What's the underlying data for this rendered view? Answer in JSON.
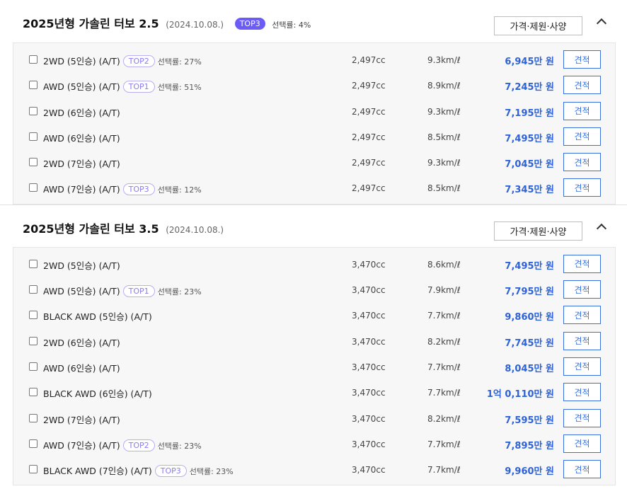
{
  "sections": [
    {
      "title": "2025년형 가솔린 터보 2.5",
      "date": "(2024.10.08.)",
      "badge": "TOP3",
      "rate": "선택률: 4%",
      "spec_label": "가격·제원·사양",
      "trims": [
        {
          "name": "2WD (5인승) (A/T)",
          "badge": "TOP2",
          "rate": "선택률: 27%",
          "cc": "2,497cc",
          "eff": "9.3km/ℓ",
          "price": "6,945만 원",
          "quote": "견적"
        },
        {
          "name": "AWD (5인승) (A/T)",
          "badge": "TOP1",
          "rate": "선택률: 51%",
          "cc": "2,497cc",
          "eff": "8.9km/ℓ",
          "price": "7,245만 원",
          "quote": "견적"
        },
        {
          "name": "2WD (6인승) (A/T)",
          "cc": "2,497cc",
          "eff": "9.3km/ℓ",
          "price": "7,195만 원",
          "quote": "견적"
        },
        {
          "name": "AWD (6인승) (A/T)",
          "cc": "2,497cc",
          "eff": "8.5km/ℓ",
          "price": "7,495만 원",
          "quote": "견적"
        },
        {
          "name": "2WD (7인승) (A/T)",
          "cc": "2,497cc",
          "eff": "9.3km/ℓ",
          "price": "7,045만 원",
          "quote": "견적"
        },
        {
          "name": "AWD (7인승) (A/T)",
          "badge": "TOP3",
          "rate": "선택률: 12%",
          "cc": "2,497cc",
          "eff": "8.5km/ℓ",
          "price": "7,345만 원",
          "quote": "견적"
        }
      ]
    },
    {
      "title": "2025년형 가솔린 터보 3.5",
      "date": "(2024.10.08.)",
      "spec_label": "가격·제원·사양",
      "trims": [
        {
          "name": "2WD (5인승) (A/T)",
          "cc": "3,470cc",
          "eff": "8.6km/ℓ",
          "price": "7,495만 원",
          "quote": "견적"
        },
        {
          "name": "AWD (5인승) (A/T)",
          "badge": "TOP1",
          "rate": "선택률: 23%",
          "cc": "3,470cc",
          "eff": "7.9km/ℓ",
          "price": "7,795만 원",
          "quote": "견적"
        },
        {
          "name": "BLACK AWD (5인승) (A/T)",
          "cc": "3,470cc",
          "eff": "7.7km/ℓ",
          "price": "9,860만 원",
          "quote": "견적"
        },
        {
          "name": "2WD (6인승) (A/T)",
          "cc": "3,470cc",
          "eff": "8.2km/ℓ",
          "price": "7,745만 원",
          "quote": "견적"
        },
        {
          "name": "AWD (6인승) (A/T)",
          "cc": "3,470cc",
          "eff": "7.7km/ℓ",
          "price": "8,045만 원",
          "quote": "견적"
        },
        {
          "name": "BLACK AWD (6인승) (A/T)",
          "cc": "3,470cc",
          "eff": "7.7km/ℓ",
          "price": "1억 0,110만 원",
          "quote": "견적"
        },
        {
          "name": "2WD (7인승) (A/T)",
          "cc": "3,470cc",
          "eff": "8.2km/ℓ",
          "price": "7,595만 원",
          "quote": "견적"
        },
        {
          "name": "AWD (7인승) (A/T)",
          "badge": "TOP2",
          "rate": "선택률: 23%",
          "cc": "3,470cc",
          "eff": "7.7km/ℓ",
          "price": "7,895만 원",
          "quote": "견적"
        },
        {
          "name": "BLACK AWD (7인승) (A/T)",
          "badge": "TOP3",
          "rate": "선택률: 23%",
          "cc": "3,470cc",
          "eff": "7.7km/ℓ",
          "price": "9,960만 원",
          "quote": "견적"
        }
      ]
    }
  ],
  "colors": {
    "accent": "#2d62d8",
    "badge": "#6b5cf5"
  }
}
